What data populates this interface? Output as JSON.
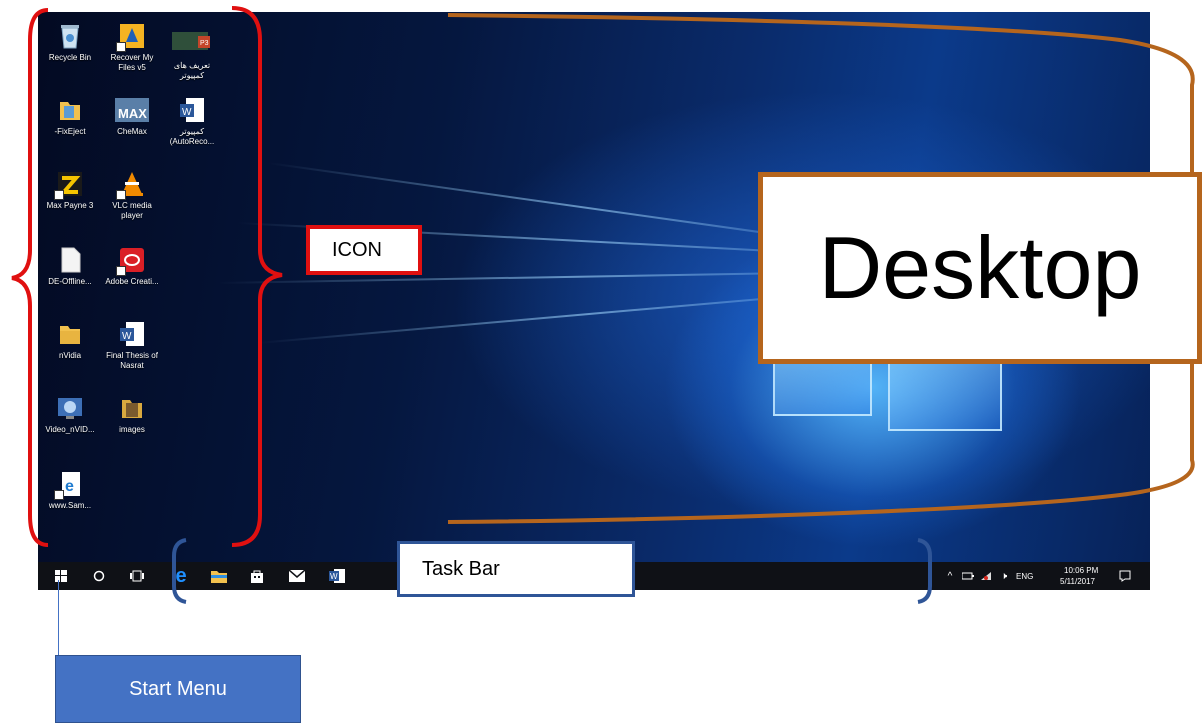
{
  "desktop_icons": [
    {
      "label": "Recycle Bin",
      "icon": "recycle-bin-icon"
    },
    {
      "label": "Recover My Files v5",
      "icon": "recover-files-icon"
    },
    {
      "label": "تعریف های کمپیوتر",
      "icon": "powerpoint-file-icon"
    },
    {
      "label": "-FixEject",
      "icon": "folder-icon"
    },
    {
      "label": "CheMax",
      "icon": "chemax-icon"
    },
    {
      "label": "کمپیوتر (AutoReco...",
      "icon": "word-document-icon"
    },
    {
      "label": "Max Payne 3",
      "icon": "max-payne-icon"
    },
    {
      "label": "VLC media player",
      "icon": "vlc-icon"
    },
    {
      "label": "DE-Offline...",
      "icon": "blank-file-icon"
    },
    {
      "label": "Adobe Creati...",
      "icon": "adobe-creative-cloud-icon"
    },
    {
      "label": "nVidia",
      "icon": "folder-icon"
    },
    {
      "label": "Final Thesis of Nasrat",
      "icon": "word-document-icon"
    },
    {
      "label": "Video_nVID...",
      "icon": "video-icon"
    },
    {
      "label": "images",
      "icon": "folder-icon"
    },
    {
      "label": "www.Sam...",
      "icon": "edge-link-icon"
    }
  ],
  "taskbar": {
    "items": [
      "start-icon",
      "cortana-icon",
      "task-view-icon",
      "edge-icon",
      "file-explorer-icon",
      "store-icon",
      "mail-icon",
      "word-icon"
    ],
    "tray": {
      "language": "ENG",
      "time": "10:06 PM",
      "date": "5/11/2017"
    }
  },
  "annotations": {
    "icon": "ICON",
    "desktop": "Desktop",
    "taskbar": "Task Bar",
    "start_menu": "Start Menu"
  },
  "colors": {
    "icon_annotation": "#e01010",
    "desktop_annotation": "#b5651d",
    "taskbar_annotation": "#2f5597",
    "start_annotation": "#4472c4"
  }
}
